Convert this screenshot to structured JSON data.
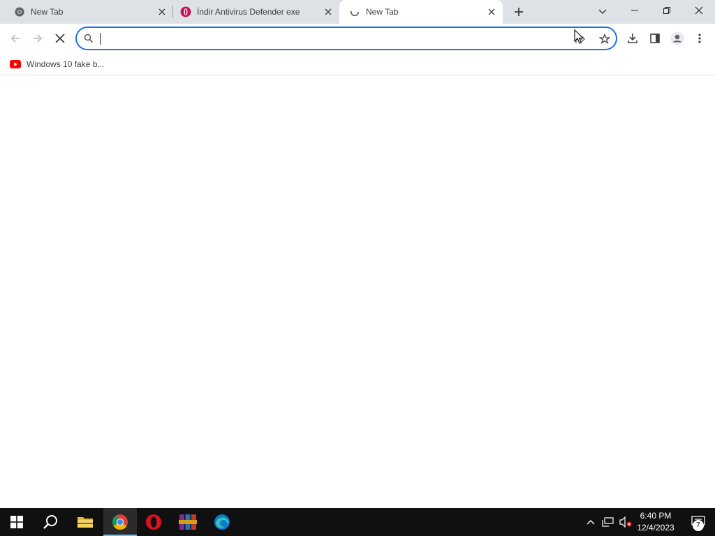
{
  "tabs": [
    {
      "title": "New Tab",
      "favicon": "chrome-icon",
      "active": false
    },
    {
      "title": "İndir Antivirus Defender exe",
      "favicon": "opera-gx-icon",
      "active": false
    },
    {
      "title": "New Tab",
      "favicon": "loading-globe-icon",
      "active": true
    }
  ],
  "toolbar": {
    "omnibox_value": "",
    "omnibox_placeholder": ""
  },
  "bookmarks": [
    {
      "label": "Windows 10 fake b...",
      "icon": "youtube-icon"
    }
  ],
  "taskbar": {
    "apps": [
      "windows-start-icon",
      "search-icon",
      "file-explorer-icon",
      "chrome-icon",
      "opera-icon",
      "winrar-icon",
      "edge-icon"
    ],
    "time": "6:40 PM",
    "date": "12/4/2023",
    "notification_count": "7"
  },
  "colors": {
    "accent": "#1a73e8",
    "tabstrip": "#dee1e6",
    "taskbar": "#101010"
  }
}
